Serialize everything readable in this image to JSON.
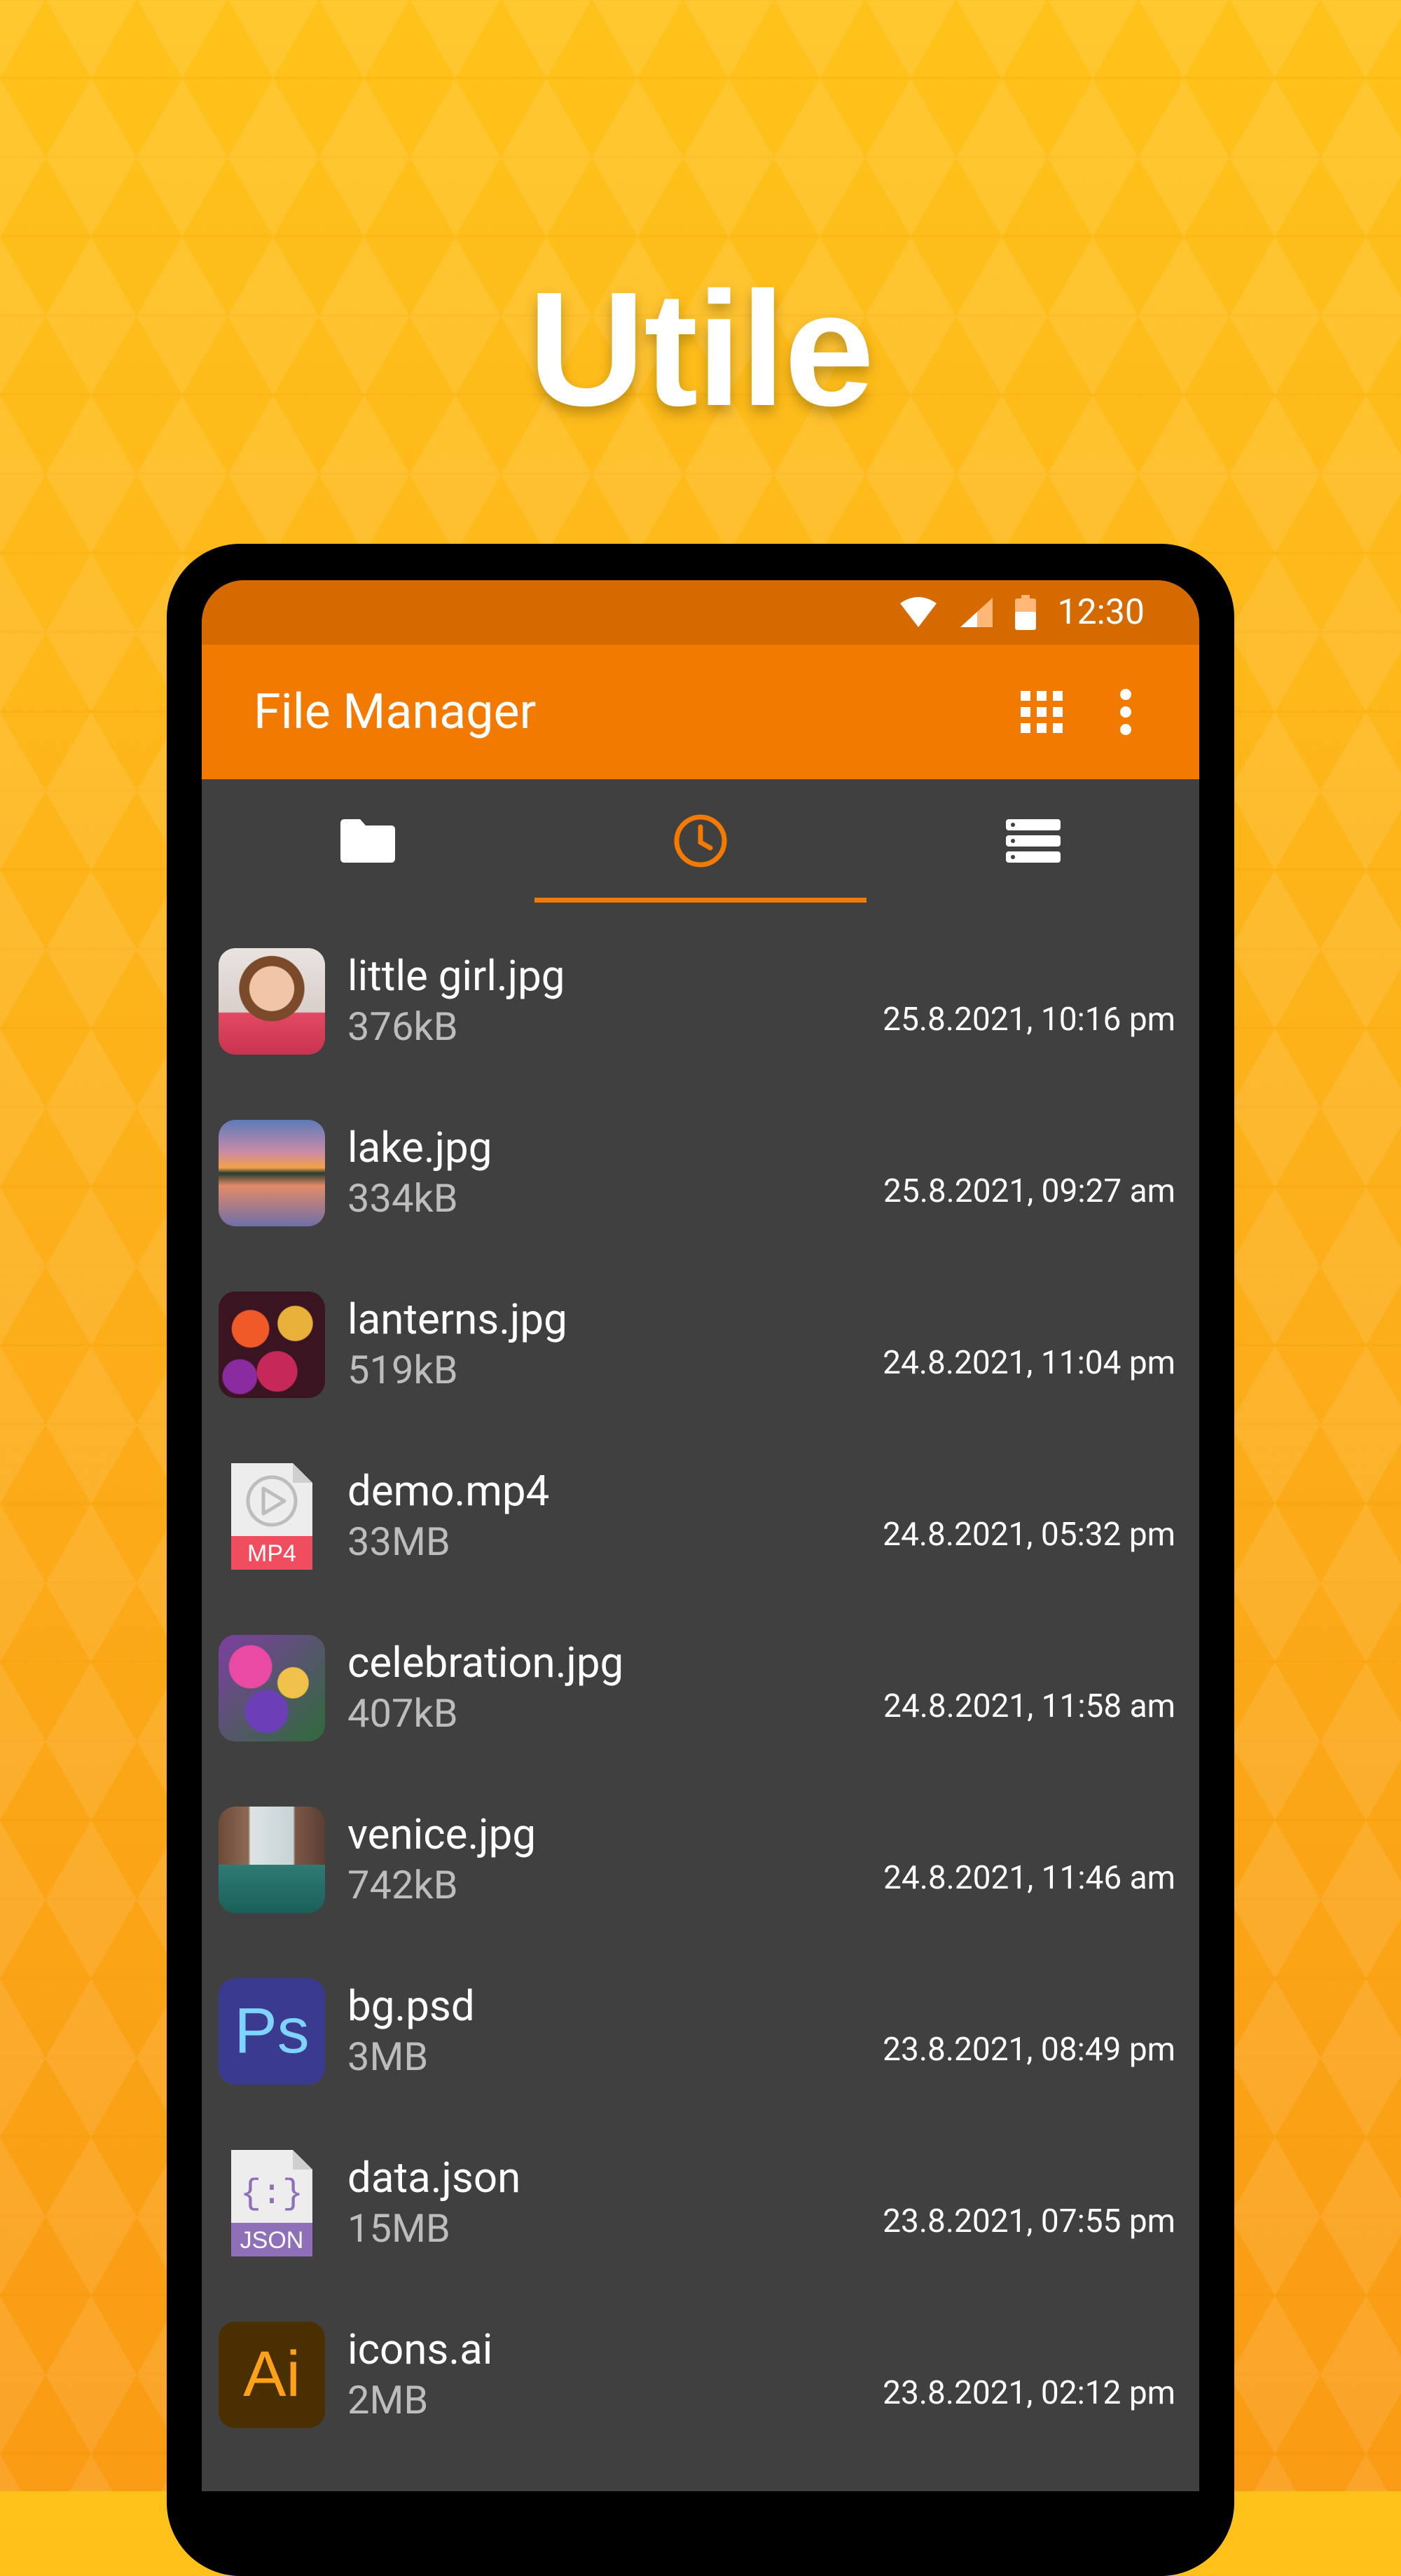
{
  "headline": "Utile",
  "status": {
    "time": "12:30"
  },
  "appbar": {
    "title": "File Manager"
  },
  "tabs": [
    {
      "icon": "folder-icon",
      "active": false
    },
    {
      "icon": "clock-icon",
      "active": true
    },
    {
      "icon": "storage-icon",
      "active": false
    }
  ],
  "files": [
    {
      "name": "little girl.jpg",
      "size": "376kB",
      "date": "25.8.2021, 10:16 pm",
      "thumb": "photo-girl"
    },
    {
      "name": "lake.jpg",
      "size": "334kB",
      "date": "25.8.2021, 09:27 am",
      "thumb": "photo-lake"
    },
    {
      "name": "lanterns.jpg",
      "size": "519kB",
      "date": "24.8.2021, 11:04 pm",
      "thumb": "photo-lanterns"
    },
    {
      "name": "demo.mp4",
      "size": "33MB",
      "date": "24.8.2021, 05:32 pm",
      "thumb": "mp4-file-icon",
      "badge": "MP4"
    },
    {
      "name": "celebration.jpg",
      "size": "407kB",
      "date": "24.8.2021, 11:58 am",
      "thumb": "photo-celebration"
    },
    {
      "name": "venice.jpg",
      "size": "742kB",
      "date": "24.8.2021, 11:46 am",
      "thumb": "photo-venice"
    },
    {
      "name": "bg.psd",
      "size": "3MB",
      "date": "23.8.2021, 08:49 pm",
      "thumb": "photoshop-icon",
      "badge": "Ps"
    },
    {
      "name": "data.json",
      "size": "15MB",
      "date": "23.8.2021, 07:55 pm",
      "thumb": "json-file-icon",
      "badge": "JSON",
      "glyph": "{:}"
    },
    {
      "name": "icons.ai",
      "size": "2MB",
      "date": "23.8.2021, 02:12 pm",
      "thumb": "illustrator-icon",
      "badge": "Ai"
    }
  ],
  "colors": {
    "accent": "#F27A00",
    "statusbar": "#D46A00",
    "background": "#404040"
  }
}
